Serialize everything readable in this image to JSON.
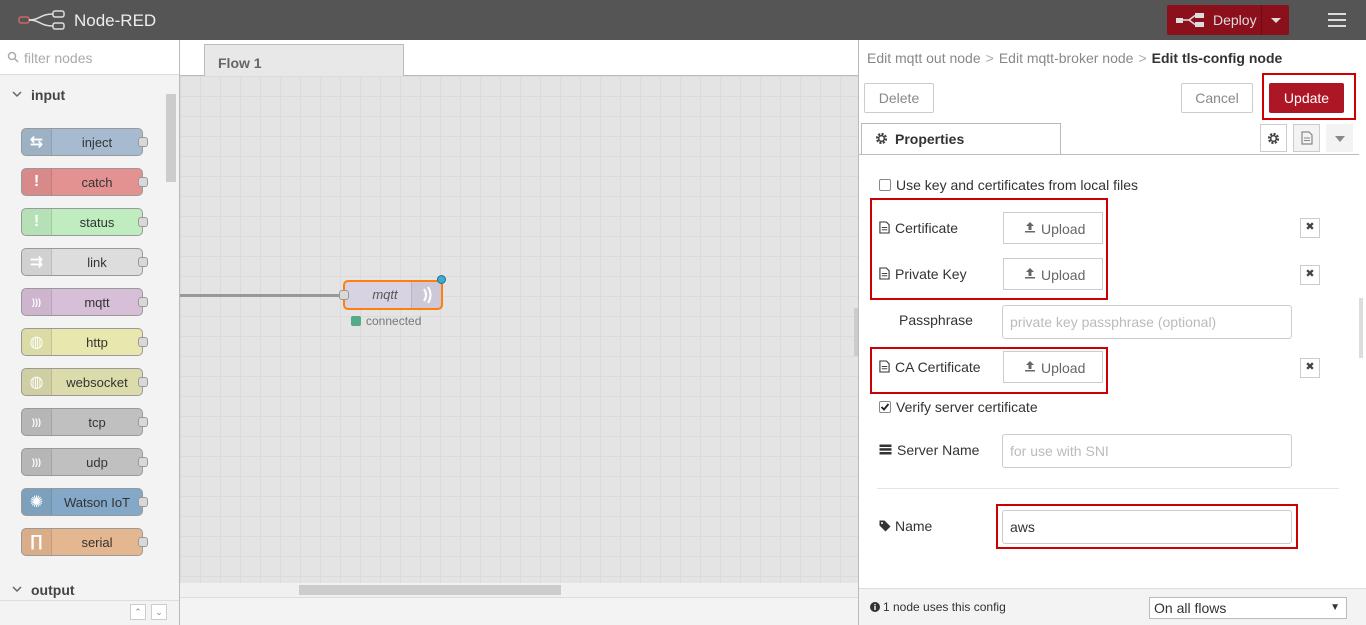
{
  "header": {
    "app_title": "Node-RED",
    "deploy_label": "Deploy",
    "brand_color": "#8c101c"
  },
  "palette": {
    "search_placeholder": "filter nodes",
    "categories": [
      {
        "label": "input"
      },
      {
        "label": "output"
      }
    ],
    "nodes": [
      {
        "label": "inject",
        "color": "#a6bbcf",
        "icon": "inject-arrows-icon"
      },
      {
        "label": "catch",
        "color": "#e49191",
        "icon": "exclamation-icon"
      },
      {
        "label": "status",
        "color": "#c0edc0",
        "icon": "exclamation-icon"
      },
      {
        "label": "link",
        "color": "#dddddd",
        "icon": "link-icon"
      },
      {
        "label": "mqtt",
        "color": "#d8bfd8",
        "icon": "bridge-icon"
      },
      {
        "label": "http",
        "color": "#e7e7ae",
        "icon": "globe-icon"
      },
      {
        "label": "websocket",
        "color": "#dbdbac",
        "icon": "globe-icon"
      },
      {
        "label": "tcp",
        "color": "#c0c0c0",
        "icon": "bridge-icon"
      },
      {
        "label": "udp",
        "color": "#c0c0c0",
        "icon": "bridge-icon"
      },
      {
        "label": "Watson IoT",
        "color": "#84a9c8",
        "icon": "watson-icon"
      },
      {
        "label": "serial",
        "color": "#e5b790",
        "icon": "serial-icon"
      }
    ]
  },
  "workspace": {
    "tab_label": "Flow 1",
    "node": {
      "label": "mqtt",
      "status": "connected"
    }
  },
  "editor": {
    "breadcrumb": [
      "Edit mqtt out node",
      "Edit mqtt-broker node",
      "Edit tls-config node"
    ],
    "delete_label": "Delete",
    "cancel_label": "Cancel",
    "update_label": "Update",
    "properties_tab": "Properties",
    "use_local_files_label": "Use key and certificates from local files",
    "use_local_files_checked": false,
    "certificate_label": "Certificate",
    "private_key_label": "Private Key",
    "ca_certificate_label": "CA Certificate",
    "upload_label": "Upload",
    "clear_symbol": "✖",
    "passphrase_label": "Passphrase",
    "passphrase_placeholder": "private key passphrase (optional)",
    "verify_label": "Verify server certificate",
    "verify_checked": true,
    "server_name_label": "Server Name",
    "server_name_placeholder": "for use with SNI",
    "name_label": "Name",
    "name_value": "aws",
    "footer_info": "1 node uses this config",
    "scope_value": "On all flows"
  }
}
